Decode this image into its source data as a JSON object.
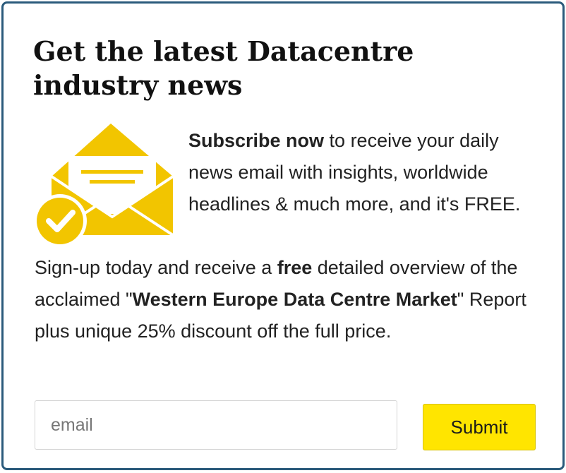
{
  "widget": {
    "title": "Get the latest Datacentre industry news",
    "subscribe": {
      "lead_bold": "Subscribe now",
      "rest": " to receive your daily news email with insights, worldwide headlines & much more, and it's FREE."
    },
    "offer": {
      "part1": "Sign-up today and receive a ",
      "bold1": "free",
      "part2": " detailed overview of the acclaimed \"",
      "bold2": "Western Europe Data Centre Market",
      "part3": "\" Report plus unique 25% discount off the full price."
    },
    "form": {
      "email_placeholder": "email",
      "email_value": "",
      "submit_label": "Submit"
    },
    "icons": {
      "envelope": "envelope-check-icon"
    },
    "colors": {
      "accent_yellow": "#FFE500",
      "icon_yellow": "#F2C500",
      "border_blue": "#2A5A7B"
    }
  }
}
